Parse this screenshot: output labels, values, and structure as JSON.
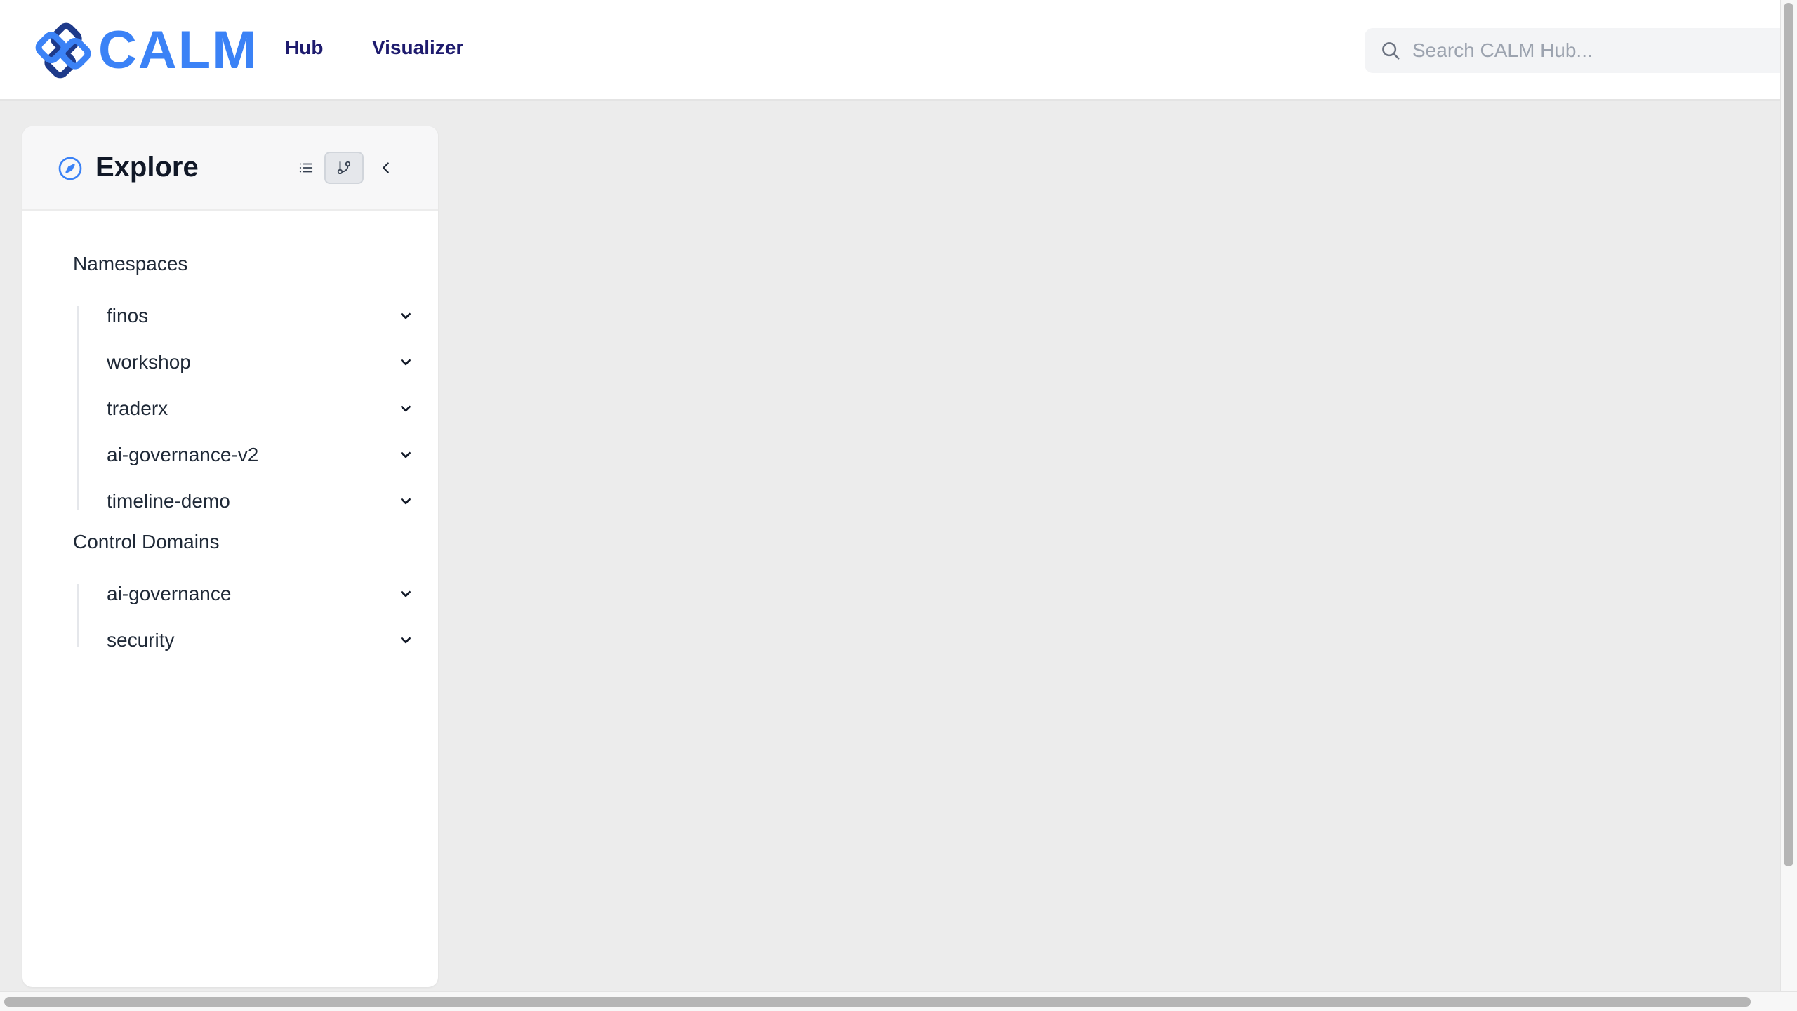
{
  "header": {
    "logo_text": "CALM",
    "nav": [
      {
        "label": "Hub"
      },
      {
        "label": "Visualizer"
      }
    ],
    "search": {
      "placeholder": "Search CALM Hub...",
      "value": ""
    }
  },
  "sidebar": {
    "title": "Explore",
    "groups": [
      {
        "label": "Namespaces",
        "items": [
          {
            "label": "finos"
          },
          {
            "label": "workshop"
          },
          {
            "label": "traderx"
          },
          {
            "label": "ai-governance-v2"
          },
          {
            "label": "timeline-demo"
          }
        ]
      },
      {
        "label": "Control Domains",
        "items": [
          {
            "label": "ai-governance"
          },
          {
            "label": "security"
          }
        ]
      }
    ]
  },
  "colors": {
    "brand": "#3b82f6",
    "brand_dark": "#1e3a8a",
    "nav_text": "#1e1b6e",
    "background": "#ececec"
  },
  "icons": {
    "search": "search-icon",
    "compass": "compass-icon",
    "list_view": "list-icon",
    "tree_view": "git-branch-icon",
    "collapse": "chevron-left-icon",
    "expand": "chevron-down-icon"
  }
}
